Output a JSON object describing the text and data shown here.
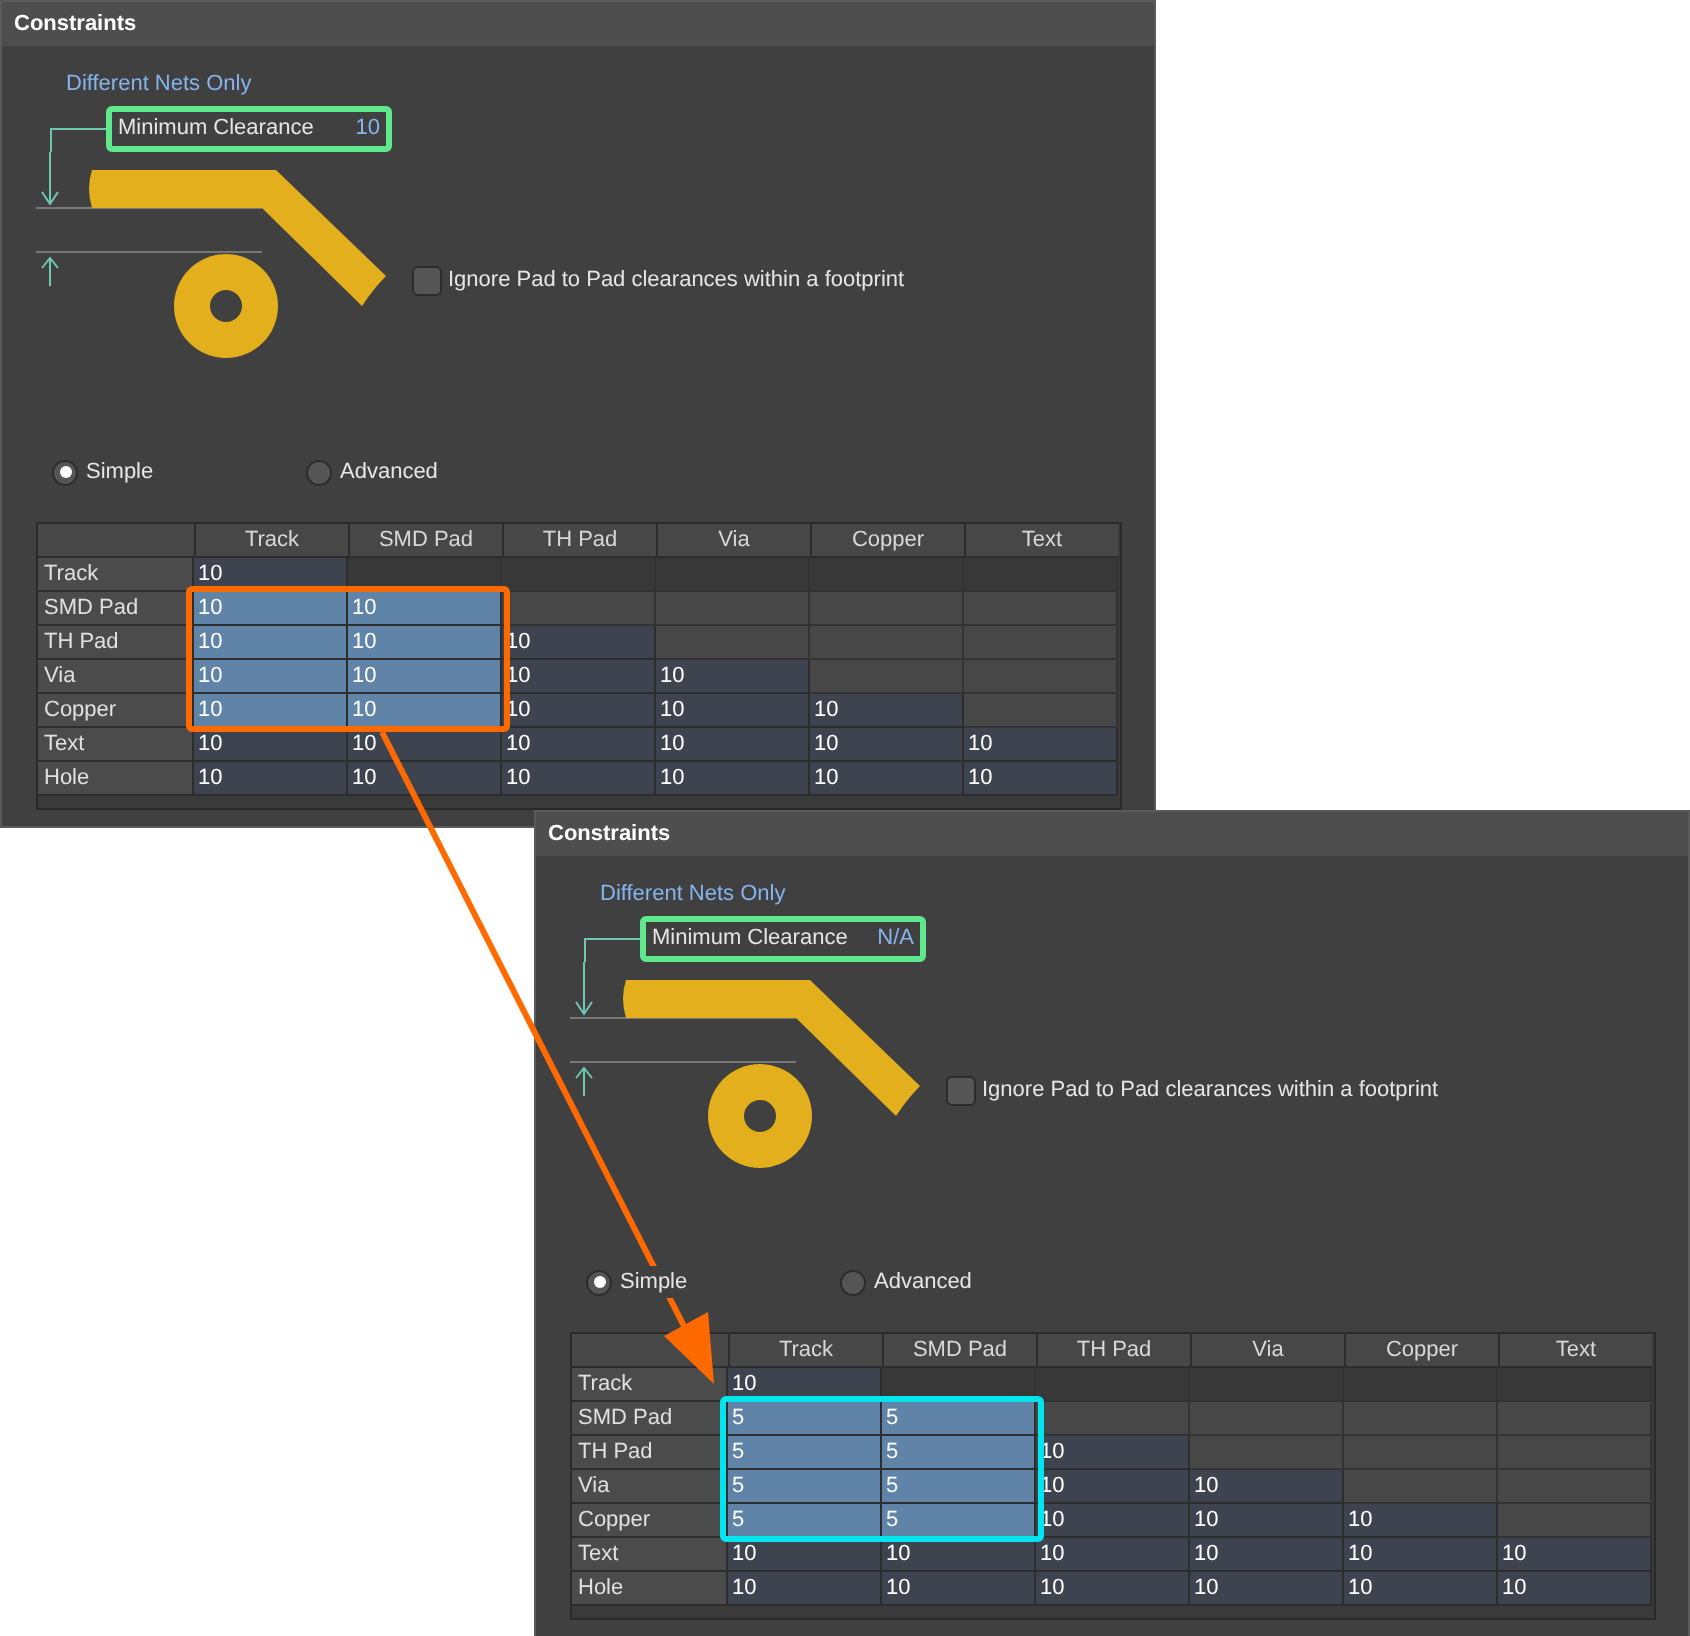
{
  "panels": [
    {
      "title": "Constraints",
      "scope_label": "Different Nets Only",
      "field": {
        "label": "Minimum Clearance",
        "value": "10"
      },
      "checkbox": {
        "label": "Ignore Pad to Pad clearances within a footprint",
        "checked": false
      },
      "modes": [
        {
          "label": "Simple",
          "selected": true
        },
        {
          "label": "Advanced",
          "selected": false
        }
      ],
      "table": {
        "columns": [
          "Track",
          "SMD Pad",
          "TH Pad",
          "Via",
          "Copper",
          "Text"
        ],
        "rows": [
          {
            "label": "Track",
            "cells": [
              {
                "value": "10",
                "selected": false
              }
            ]
          },
          {
            "label": "SMD Pad",
            "cells": [
              {
                "value": "10",
                "selected": true
              },
              {
                "value": "10",
                "selected": true
              }
            ]
          },
          {
            "label": "TH Pad",
            "cells": [
              {
                "value": "10",
                "selected": true
              },
              {
                "value": "10",
                "selected": true
              },
              {
                "value": "10",
                "selected": false
              }
            ]
          },
          {
            "label": "Via",
            "cells": [
              {
                "value": "10",
                "selected": true
              },
              {
                "value": "10",
                "selected": true
              },
              {
                "value": "10",
                "selected": false
              },
              {
                "value": "10",
                "selected": false
              }
            ]
          },
          {
            "label": "Copper",
            "cells": [
              {
                "value": "10",
                "selected": true
              },
              {
                "value": "10",
                "selected": true
              },
              {
                "value": "10",
                "selected": false
              },
              {
                "value": "10",
                "selected": false
              },
              {
                "value": "10",
                "selected": false
              }
            ]
          },
          {
            "label": "Text",
            "cells": [
              {
                "value": "10",
                "selected": false
              },
              {
                "value": "10",
                "selected": false
              },
              {
                "value": "10",
                "selected": false
              },
              {
                "value": "10",
                "selected": false
              },
              {
                "value": "10",
                "selected": false
              },
              {
                "value": "10",
                "selected": false
              }
            ]
          },
          {
            "label": "Hole",
            "cells": [
              {
                "value": "10",
                "selected": false
              },
              {
                "value": "10",
                "selected": false
              },
              {
                "value": "10",
                "selected": false
              },
              {
                "value": "10",
                "selected": false
              },
              {
                "value": "10",
                "selected": false
              },
              {
                "value": "10",
                "selected": false
              }
            ]
          }
        ]
      }
    },
    {
      "title": "Constraints",
      "scope_label": "Different Nets Only",
      "field": {
        "label": "Minimum Clearance",
        "value": "N/A"
      },
      "checkbox": {
        "label": "Ignore Pad to Pad clearances within a footprint",
        "checked": false
      },
      "modes": [
        {
          "label": "Simple",
          "selected": true
        },
        {
          "label": "Advanced",
          "selected": false
        }
      ],
      "table": {
        "columns": [
          "Track",
          "SMD Pad",
          "TH Pad",
          "Via",
          "Copper",
          "Text"
        ],
        "rows": [
          {
            "label": "Track",
            "cells": [
              {
                "value": "10",
                "selected": false
              }
            ]
          },
          {
            "label": "SMD Pad",
            "cells": [
              {
                "value": "5",
                "selected": true
              },
              {
                "value": "5",
                "selected": true
              }
            ]
          },
          {
            "label": "TH Pad",
            "cells": [
              {
                "value": "5",
                "selected": true
              },
              {
                "value": "5",
                "selected": true
              },
              {
                "value": "10",
                "selected": false
              }
            ]
          },
          {
            "label": "Via",
            "cells": [
              {
                "value": "5",
                "selected": true
              },
              {
                "value": "5",
                "selected": true
              },
              {
                "value": "10",
                "selected": false
              },
              {
                "value": "10",
                "selected": false
              }
            ]
          },
          {
            "label": "Copper",
            "cells": [
              {
                "value": "5",
                "selected": true
              },
              {
                "value": "5",
                "selected": true
              },
              {
                "value": "10",
                "selected": false
              },
              {
                "value": "10",
                "selected": false
              },
              {
                "value": "10",
                "selected": false
              }
            ]
          },
          {
            "label": "Text",
            "cells": [
              {
                "value": "10",
                "selected": false
              },
              {
                "value": "10",
                "selected": false
              },
              {
                "value": "10",
                "selected": false
              },
              {
                "value": "10",
                "selected": false
              },
              {
                "value": "10",
                "selected": false
              },
              {
                "value": "10",
                "selected": false
              }
            ]
          },
          {
            "label": "Hole",
            "cells": [
              {
                "value": "10",
                "selected": false
              },
              {
                "value": "10",
                "selected": false
              },
              {
                "value": "10",
                "selected": false
              },
              {
                "value": "10",
                "selected": false
              },
              {
                "value": "10",
                "selected": false
              },
              {
                "value": "10",
                "selected": false
              }
            ]
          }
        ]
      }
    }
  ]
}
